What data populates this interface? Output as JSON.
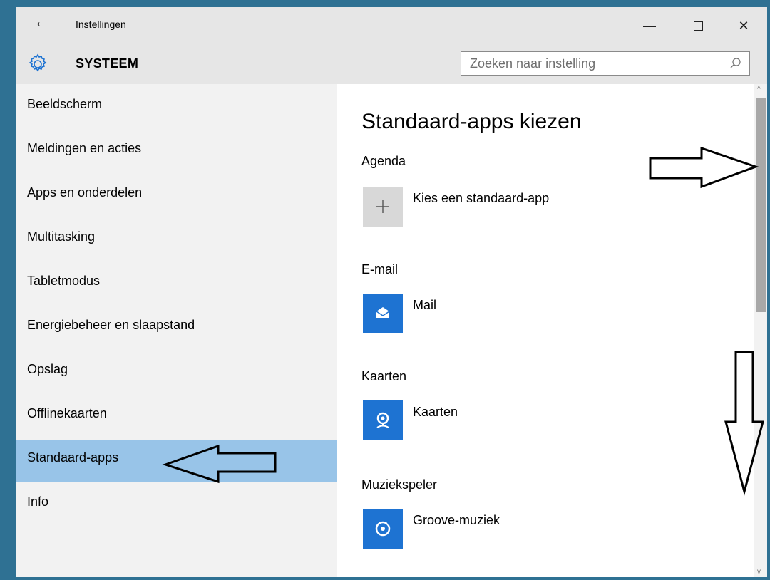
{
  "window": {
    "title": "Instellingen",
    "back_glyph": "←",
    "minimize_glyph": "—",
    "close_glyph": "✕"
  },
  "header": {
    "section": "SYSTEEM",
    "search_placeholder": "Zoeken naar instelling"
  },
  "sidebar": {
    "items": [
      {
        "label": "Beeldscherm"
      },
      {
        "label": "Meldingen en acties"
      },
      {
        "label": "Apps en onderdelen"
      },
      {
        "label": "Multitasking"
      },
      {
        "label": "Tabletmodus"
      },
      {
        "label": "Energiebeheer en slaapstand"
      },
      {
        "label": "Opslag"
      },
      {
        "label": "Offlinekaarten"
      },
      {
        "label": "Standaard-apps"
      },
      {
        "label": "Info"
      }
    ],
    "active": "Standaard-apps"
  },
  "main": {
    "title": "Standaard-apps kiezen",
    "sections": [
      {
        "category": "Agenda",
        "app": "Kies een standaard-app",
        "icon": "plus-icon"
      },
      {
        "category": "E-mail",
        "app": "Mail",
        "icon": "mail-icon"
      },
      {
        "category": "Kaarten",
        "app": "Kaarten",
        "icon": "maps-icon"
      },
      {
        "category": "Muziekspeler",
        "app": "Groove-muziek",
        "icon": "groove-icon"
      }
    ]
  },
  "colors": {
    "frame": "#2f7193",
    "active_item": "#98c4e8",
    "app_tile": "#1e73d2"
  }
}
